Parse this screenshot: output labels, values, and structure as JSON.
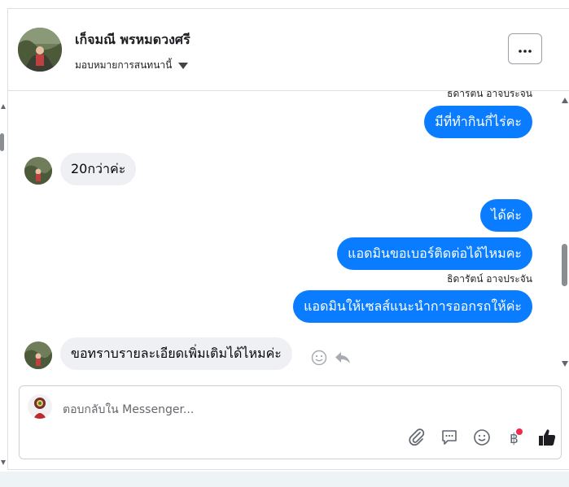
{
  "header": {
    "contact_name": "เก็จมณี พรหมดวงศรี",
    "assign_label": "มอบหมายการสนทนานี้"
  },
  "messages": [
    {
      "sender": "ธิดารัตน์ อาจประจัน",
      "partial": true
    },
    {
      "dir": "out",
      "text": "มีที่ทำกินกี่ไร่คะ"
    },
    {
      "dir": "in",
      "text": "20กว่าค่ะ"
    },
    {
      "dir": "out",
      "text": "ได้ค่ะ"
    },
    {
      "dir": "out",
      "text": "แอดมินขอเบอร์ติดต่อได้ไหมคะ"
    },
    {
      "sender": "ธิดารัตน์ อาจประจัน"
    },
    {
      "dir": "out",
      "text": "แอดมินให้เซลส์แนะนำการออกรถให้ค่ะ"
    },
    {
      "dir": "in",
      "text": "ขอทราบรายละเอียดเพิ่มเติมได้ไหมค่ะ"
    }
  ],
  "composer": {
    "placeholder": "ตอบกลับใน Messenger..."
  },
  "tools": [
    "paperclip-icon",
    "chat-bubble-icon",
    "smiley-icon",
    "baht-icon",
    "thumbs-up-icon"
  ],
  "colors": {
    "outgoing": "#0a7cff",
    "incoming": "#eef0f3",
    "notification_dot": "#f02849"
  }
}
